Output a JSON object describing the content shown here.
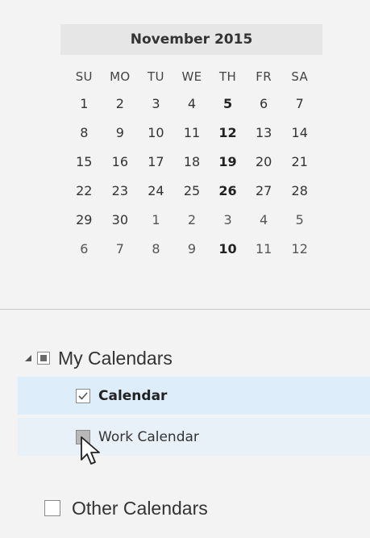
{
  "calendar": {
    "month_title": "November 2015",
    "weekdays": [
      "SU",
      "MO",
      "TU",
      "WE",
      "TH",
      "FR",
      "SA"
    ],
    "weeks": [
      [
        "1",
        "2",
        "3",
        "4",
        "5",
        "6",
        "7"
      ],
      [
        "8",
        "9",
        "10",
        "11",
        "12",
        "13",
        "14"
      ],
      [
        "15",
        "16",
        "17",
        "18",
        "19",
        "20",
        "21"
      ],
      [
        "22",
        "23",
        "24",
        "25",
        "26",
        "27",
        "28"
      ],
      [
        "29",
        "30",
        "1",
        "2",
        "3",
        "4",
        "5"
      ],
      [
        "6",
        "7",
        "8",
        "9",
        "10",
        "11",
        "12"
      ]
    ],
    "bold_days": [
      "5",
      "12",
      "19",
      "26",
      "10"
    ]
  },
  "folders": {
    "my_calendars": {
      "label": "My Calendars",
      "state": "partial",
      "expanded": true,
      "items": [
        {
          "label": "Calendar",
          "checked": true,
          "bold": true
        },
        {
          "label": "Work Calendar",
          "checked": false,
          "bold": false
        }
      ]
    },
    "other_calendars": {
      "label": "Other Calendars",
      "checked": false
    }
  },
  "colors": {
    "background": "#f3f3f3",
    "header_bg": "#e6e6e6",
    "selected_row": "#ddeefa",
    "hover_row": "#e8f1f8"
  },
  "icons": {
    "expand": "triangle-down-right-icon",
    "checkmark": "checkmark-icon",
    "cursor": "mouse-pointer-icon"
  }
}
